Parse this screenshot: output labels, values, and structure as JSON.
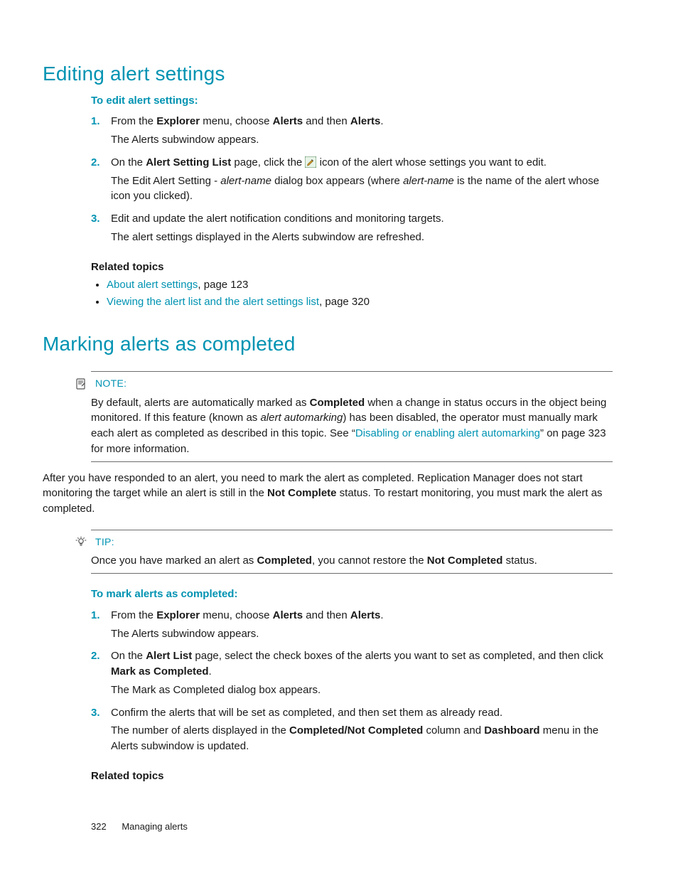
{
  "section1": {
    "title": "Editing alert settings",
    "lead": "To edit alert settings:",
    "steps": [
      {
        "num": "1.",
        "line_parts": [
          "From the ",
          "Explorer",
          " menu, choose ",
          "Alerts",
          " and then ",
          "Alerts",
          "."
        ],
        "sub": "The Alerts subwindow appears."
      },
      {
        "num": "2.",
        "line_parts": [
          "On the ",
          "Alert Setting List",
          " page, click the ",
          " icon of the alert whose settings you want to edit."
        ],
        "sub_parts": [
          "The Edit Alert Setting - ",
          "alert-name",
          " dialog box appears (where ",
          "alert-name",
          " is the name of the alert whose icon you clicked)."
        ]
      },
      {
        "num": "3.",
        "line": "Edit and update the alert notification conditions and monitoring targets.",
        "sub": "The alert settings displayed in the Alerts subwindow are refreshed."
      }
    ],
    "related_head": "Related topics",
    "related": [
      {
        "link": "About alert settings",
        "rest": ", page 123"
      },
      {
        "link": "Viewing the alert list and the alert settings list",
        "rest": ", page 320"
      }
    ]
  },
  "section2": {
    "title": "Marking alerts as completed",
    "note": {
      "label": "NOTE:",
      "parts": [
        "By default, alerts are automatically marked as ",
        "Completed",
        " when a change in status occurs in the object being monitored. If this feature (known as ",
        "alert automarking",
        ") has been disabled, the operator must manually mark each alert as completed as described in this topic. See “"
      ],
      "link": "Disabling or enabling alert automarking",
      "tail": "” on page 323 for more information."
    },
    "para_parts": [
      "After you have responded to an alert, you need to mark the alert as completed. Replication Manager does not start monitoring the target while an alert is still in the ",
      "Not Complete",
      " status. To restart monitoring, you must mark the alert as completed."
    ],
    "tip": {
      "label": "TIP:",
      "parts": [
        "Once you have marked an alert as ",
        "Completed",
        ", you cannot restore the ",
        "Not Completed",
        " status."
      ]
    },
    "lead": "To mark alerts as completed:",
    "steps": [
      {
        "num": "1.",
        "line_parts": [
          "From the ",
          "Explorer",
          " menu, choose ",
          "Alerts",
          " and then ",
          "Alerts",
          "."
        ],
        "sub": "The Alerts subwindow appears."
      },
      {
        "num": "2.",
        "line_parts": [
          "On the ",
          "Alert List",
          " page, select the check boxes of the alerts you want to set as completed, and then click ",
          "Mark as Completed",
          "."
        ],
        "sub": "The Mark as Completed dialog box appears."
      },
      {
        "num": "3.",
        "line": "Confirm the alerts that will be set as completed, and then set them as already read.",
        "sub_parts": [
          "The number of alerts displayed in the ",
          "Completed/Not Completed",
          " column and ",
          "Dashboard",
          " menu in the Alerts subwindow is updated."
        ]
      }
    ],
    "related_head": "Related topics"
  },
  "footer": {
    "page": "322",
    "chapter": "Managing alerts"
  }
}
